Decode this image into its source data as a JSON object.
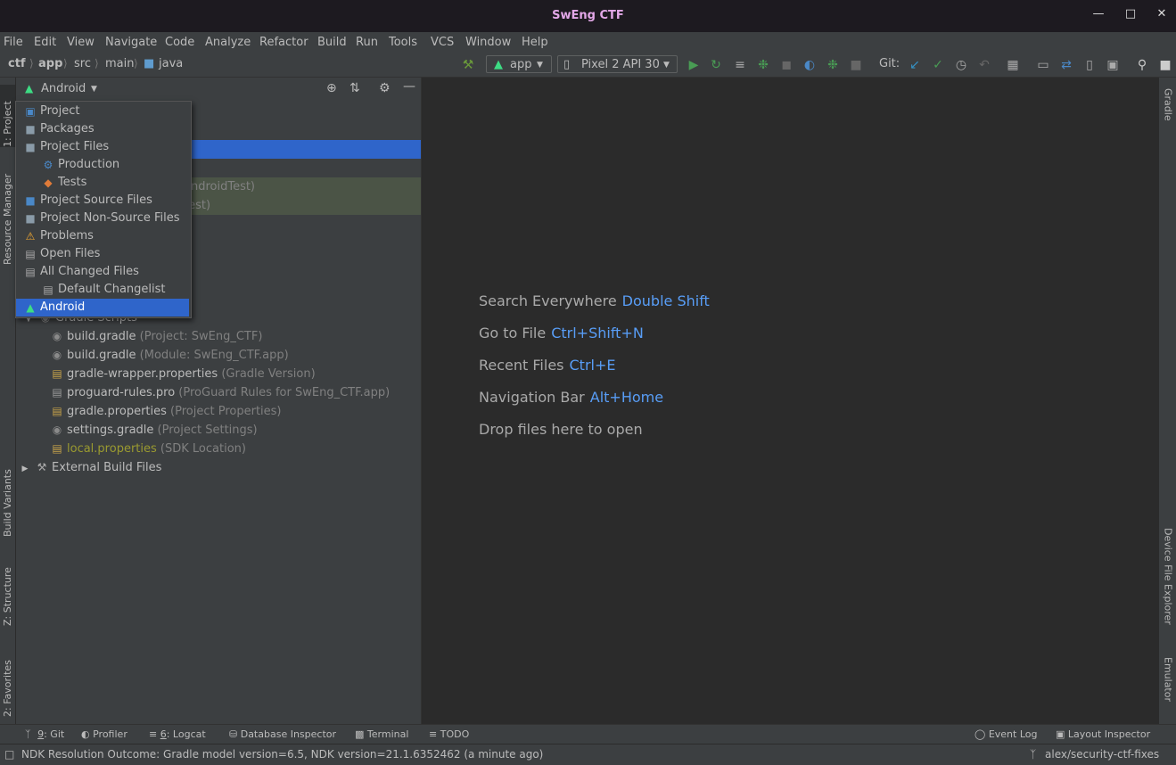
{
  "window": {
    "title": "SwEng CTF"
  },
  "menu": [
    "File",
    "Edit",
    "View",
    "Navigate",
    "Code",
    "Analyze",
    "Refactor",
    "Build",
    "Run",
    "Tools",
    "VCS",
    "Window",
    "Help"
  ],
  "breadcrumb": [
    "ctf",
    "app",
    "src",
    "main",
    "java"
  ],
  "toolbar": {
    "run_config": "app",
    "device": "Pixel 2 API 30",
    "git_label": "Git:"
  },
  "left_tabs": {
    "project": "1: Project",
    "resource_manager": "Resource Manager",
    "build_variants": "Build Variants",
    "structure": "Z: Structure",
    "favorites": "2: Favorites"
  },
  "right_tabs": {
    "gradle": "Gradle",
    "device_file_explorer": "Device File Explorer",
    "emulator": "Emulator"
  },
  "project_panel": {
    "view_selector": "Android",
    "partial_rows": [
      "androidTest)",
      "test)"
    ],
    "tree": [
      {
        "name": "Gradle Scripts",
        "detail": "",
        "icon": "gradle-icon"
      },
      {
        "name": "build.gradle",
        "detail": "(Project: SwEng_CTF)",
        "icon": "gradle-icon"
      },
      {
        "name": "build.gradle",
        "detail": "(Module: SwEng_CTF.app)",
        "icon": "gradle-icon"
      },
      {
        "name": "gradle-wrapper.properties",
        "detail": "(Gradle Version)",
        "icon": "properties-icon"
      },
      {
        "name": "proguard-rules.pro",
        "detail": "(ProGuard Rules for SwEng_CTF.app)",
        "icon": "file-icon"
      },
      {
        "name": "gradle.properties",
        "detail": "(Project Properties)",
        "icon": "properties-icon"
      },
      {
        "name": "settings.gradle",
        "detail": "(Project Settings)",
        "icon": "gradle-icon"
      },
      {
        "name": "local.properties",
        "detail": "(SDK Location)",
        "icon": "properties-icon"
      },
      {
        "name": "External Build Files",
        "detail": "",
        "icon": "tools-icon"
      }
    ]
  },
  "view_popup": {
    "items": [
      "Project",
      "Packages",
      "Project Files",
      "Production",
      "Tests",
      "Project Source Files",
      "Project Non-Source Files",
      "Problems",
      "Open Files",
      "All Changed Files",
      "Default Changelist",
      "Android"
    ],
    "selected": "Android"
  },
  "editor_hints": [
    {
      "label": "Search Everywhere",
      "key": "Double Shift"
    },
    {
      "label": "Go to File",
      "key": "Ctrl+Shift+N"
    },
    {
      "label": "Recent Files",
      "key": "Ctrl+E"
    },
    {
      "label": "Navigation Bar",
      "key": "Alt+Home"
    },
    {
      "label": "Drop files here to open",
      "key": ""
    }
  ],
  "bottom_tools": {
    "git_num": "9",
    "git": ": Git",
    "profiler": "Profiler",
    "logcat_num": "6",
    "logcat": ": Logcat",
    "db_inspector": "Database Inspector",
    "terminal": "Terminal",
    "todo": "TODO",
    "event_log": "Event Log",
    "layout_inspector": "Layout Inspector"
  },
  "status": {
    "message": "NDK Resolution Outcome: Gradle model version=6.5, NDK version=21.1.6352462 (a minute ago)",
    "branch": "alex/security-ctf-fixes"
  },
  "colors": {
    "accent": "#2f65ca",
    "link": "#589df6",
    "android_green": "#3ddc84",
    "title_pink": "#e3a8e8"
  }
}
